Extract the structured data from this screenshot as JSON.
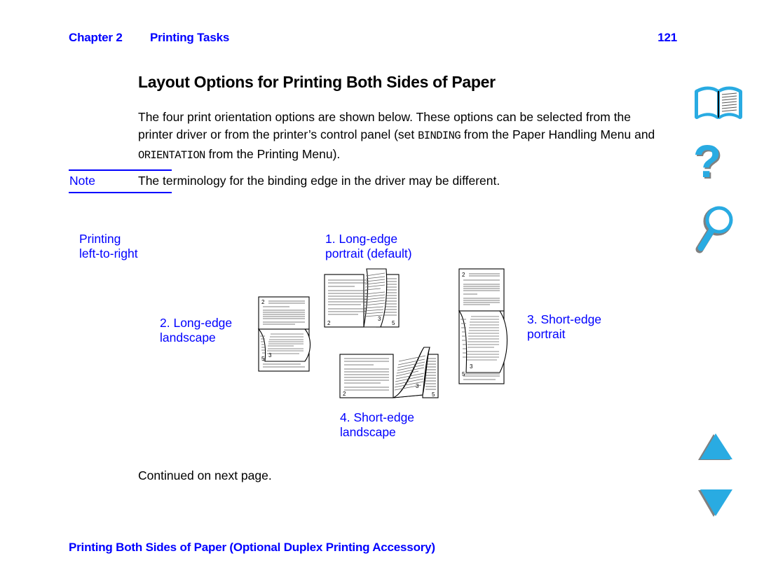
{
  "header": {
    "chapter_label": "Chapter 2",
    "chapter_title": "Printing Tasks",
    "page_number": "121"
  },
  "page_title": "Layout Options for Printing Both Sides of Paper",
  "intro": {
    "part1": "The four print orientation options are shown below. These options can be selected from the printer driver or from the printer’s control panel (set ",
    "mono1": "BINDING",
    "part2": " from the Paper Handling Menu and ",
    "mono2": "ORIENTATION",
    "part3": " from the Printing Menu)."
  },
  "note": {
    "label": "Note",
    "text": "The terminology for the binding edge in the driver may be different."
  },
  "diagram": {
    "intro_label_line1": "Printing",
    "intro_label_line2": "left-to-right",
    "option1_line1": "1. Long-edge",
    "option1_line2": "portrait (default)",
    "option2_line1": "2. Long-edge",
    "option2_line2": "landscape",
    "option3_line1": "3. Short-edge",
    "option3_line2": "portrait",
    "option4_line1": "4. Short-edge",
    "option4_line2": "landscape",
    "page_numbers": {
      "left": "2",
      "middle": "3",
      "right": "5"
    }
  },
  "continued_text": "Continued on next page.",
  "footer_title": "Printing Both Sides of Paper (Optional Duplex Printing Accessory)",
  "nav": {
    "book_label": "Table of contents",
    "help_label": "Help",
    "search_label": "Search",
    "prev_label": "Previous page",
    "next_label": "Next page"
  },
  "colors": {
    "link_blue": "#0000FF",
    "icon_cyan": "#29ABE2",
    "icon_shadow": "#808080",
    "text_black": "#000000",
    "page_background": "#FFFFFF"
  }
}
